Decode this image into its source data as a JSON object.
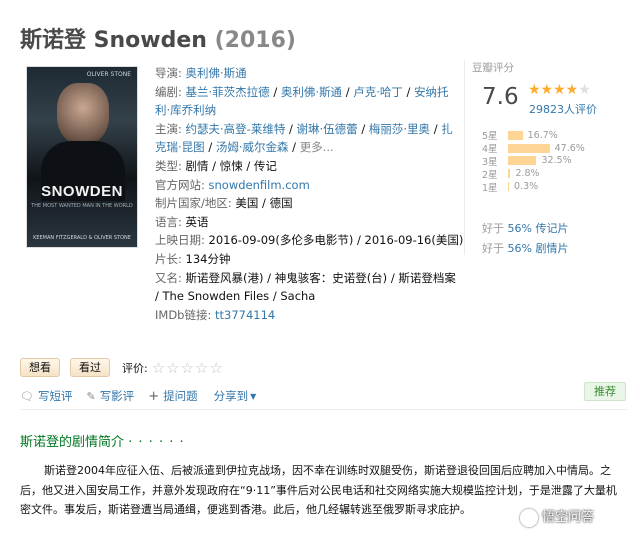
{
  "movie": {
    "title": "斯诺登 Snowden",
    "year": "(2016)"
  },
  "poster": {
    "top_credit": "OLIVER STONE",
    "name": "SNOWDEN",
    "sub": "THE MOST WANTED MAN IN THE WORLD",
    "bottom_credit": "KEEMAN FITZGERALD & OLIVER STONE"
  },
  "info": {
    "director_label": "导演:",
    "director": "奥利佛·斯通",
    "writer_label": "编剧:",
    "writers": [
      "基兰·菲茨杰拉德",
      "奥利佛·斯通",
      "卢克·哈丁",
      "安纳托",
      "利·库乔利纳"
    ],
    "cast_label": "主演:",
    "cast": [
      "约瑟夫·高登-莱维特",
      "谢琳·伍德蕾",
      "梅丽莎·里奥",
      "扎",
      "克瑞·昆图",
      "汤姆·威尔金森"
    ],
    "cast_more": "更多...",
    "genre_label": "类型:",
    "genres": "剧情 / 惊悚 / 传记",
    "site_label": "官方网站:",
    "site": "snowdenfilm.com",
    "country_label": "制片国家/地区:",
    "country": "美国 / 德国",
    "language_label": "语言:",
    "language": "英语",
    "release_label": "上映日期:",
    "release": "2016-09-09(多伦多电影节) / 2016-09-16(美国)",
    "runtime_label": "片长:",
    "runtime": "134分钟",
    "aka_label": "又名:",
    "aka_line1": "斯诺登风暴(港) / 神鬼骇客：史诺登(台) / 斯诺登档案",
    "aka_line2": "/ The Snowden Files / Sacha",
    "imdb_label": "IMDb链接:",
    "imdb": "tt3774114"
  },
  "rating": {
    "label": "豆瓣评分",
    "score": "7.6",
    "stars_on": "★★★★",
    "stars_off": "★",
    "count": "29823人评价",
    "bars": [
      {
        "star": "5星",
        "pct": "16.7%",
        "value": 16.7
      },
      {
        "star": "4星",
        "pct": "47.6%",
        "value": 47.6
      },
      {
        "star": "3星",
        "pct": "32.5%",
        "value": 32.5
      },
      {
        "star": "2星",
        "pct": "2.8%",
        "value": 2.8
      },
      {
        "star": "1星",
        "pct": "0.3%",
        "value": 0.3
      }
    ],
    "better_prefix": "好于",
    "better1_pct": "56%",
    "better1_cat": "传记片",
    "better2_pct": "56%",
    "better2_cat": "剧情片"
  },
  "actions": {
    "want": "想看",
    "seen": "看过",
    "rate_label": "评价:",
    "rate_stars": "☆☆☆☆☆"
  },
  "links": {
    "short_review": "写短评",
    "review": "写影评",
    "question": "提问题",
    "share": "分享到",
    "recommend": "推荐"
  },
  "synopsis": {
    "heading": "斯诺登的剧情简介",
    "dots": "· · · · · ·",
    "text": "斯诺登2004年应征入伍、后被派遣到伊拉克战场，因不幸在训练时双腿受伤，斯诺登退役回国后应聘加入中情局。之后，他又进入国安局工作，并意外发现政府在“9·11”事件后对公民电话和社交网络实施大规模监控计划，于是泄露了大量机密文件。事发后，斯诺登遭当局通缉，便逃到香港。此后，他几经辗转逃至俄罗斯寻求庇护。"
  },
  "watermark": {
    "text": "悟空问答"
  }
}
